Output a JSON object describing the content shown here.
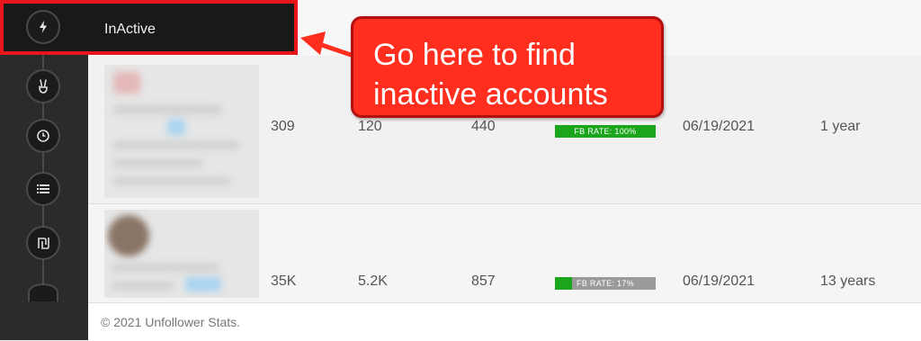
{
  "sidebar": {
    "active_item": {
      "label": "InActive",
      "icon": "bolt-icon"
    },
    "items": [
      {
        "icon": "peace-hand-icon"
      },
      {
        "icon": "clock-icon"
      },
      {
        "icon": "list-icon"
      },
      {
        "icon": "shekel-icon"
      }
    ]
  },
  "rows": [
    {
      "col1": "309",
      "col2": "120",
      "col3": "440",
      "fb_rate": "FB RATE: 100%",
      "fb_rate_value": 100,
      "date": "06/19/2021",
      "age": "1 year"
    },
    {
      "col1": "35K",
      "col2": "5.2K",
      "col3": "857",
      "fb_rate": "FB RATE: 17%",
      "fb_rate_value": 17,
      "date": "06/19/2021",
      "age": "13 years"
    }
  ],
  "footer": {
    "copyright": "© 2021 Unfollower Stats."
  },
  "callout": {
    "line1": "Go here to find",
    "line2": "inactive accounts"
  },
  "colors": {
    "highlight_red": "#e8161b",
    "fb_green": "#1aa51a",
    "fb_gray": "#9a9a9a",
    "sidebar": "#2b2b2b"
  }
}
